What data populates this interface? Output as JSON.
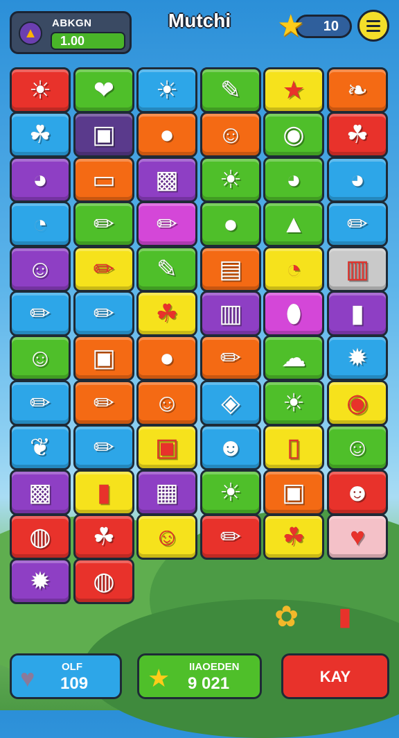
{
  "header": {
    "title": "Mutchi",
    "energy_label": "ABKGN",
    "energy_value": "1.00",
    "stars_count": "10"
  },
  "colors": {
    "red": "#e8322b",
    "green": "#4fbf2a",
    "blue": "#2da6e8",
    "yellow": "#f6e21c",
    "orange": "#f46a14",
    "purple": "#8e3fc4",
    "darkpurple": "#5a3a8c",
    "magenta": "#d447d8",
    "gray": "#c9c9c9",
    "pink": "#f4c1c8"
  },
  "board": [
    [
      "red:sun-face",
      "green:strawberry",
      "blue:sun-face",
      "green:paintbrush",
      "yellow:star",
      "orange:feather"
    ],
    [
      "blue:leaf",
      "darkpurple:box",
      "orange:chat-bubble",
      "orange:smiley",
      "green:mask",
      "red:leaf"
    ],
    [
      "purple:cat-face",
      "orange:cup",
      "purple:gamepad",
      "green:sun-face",
      "green:cat-face",
      "blue:cat-face"
    ],
    [
      "blue:bear-face",
      "green:pen",
      "magenta:pencil",
      "green:chat-bubble",
      "green:drop",
      "blue:pencil"
    ],
    [
      "purple:smiley",
      "yellow:pen",
      "green:brush",
      "orange:camera",
      "yellow:bear-face",
      "gray:truck"
    ],
    [
      "blue:pen",
      "blue:pencil",
      "yellow:leaf",
      "purple:truck",
      "magenta:egg",
      "purple:battery"
    ],
    [
      "green:smiley",
      "orange:box",
      "orange:chat-bubble",
      "orange:pencil",
      "green:cloud",
      "blue:bomb"
    ],
    [
      "blue:pencil",
      "orange:pencil",
      "orange:smiley",
      "blue:teapot",
      "green:sun-face",
      "yellow:mask"
    ],
    [
      "blue:bird",
      "blue:pen",
      "yellow:robot",
      "blue:face",
      "yellow:usb",
      "green:smiley"
    ],
    [
      "purple:gamepad",
      "yellow:battery",
      "purple:gift",
      "green:sun-face",
      "orange:robot",
      "red:face"
    ],
    [
      "red:blob",
      "red:leaf",
      "yellow:ghost",
      "red:pen",
      "yellow:leaf",
      "pink:heart"
    ],
    [
      "purple:spark",
      "red:blob"
    ]
  ],
  "bottom": {
    "left_label": "OLF",
    "left_value": "109",
    "middle_label": "IIAOEDEN",
    "middle_value": "9 021",
    "action_label": "KAY"
  }
}
